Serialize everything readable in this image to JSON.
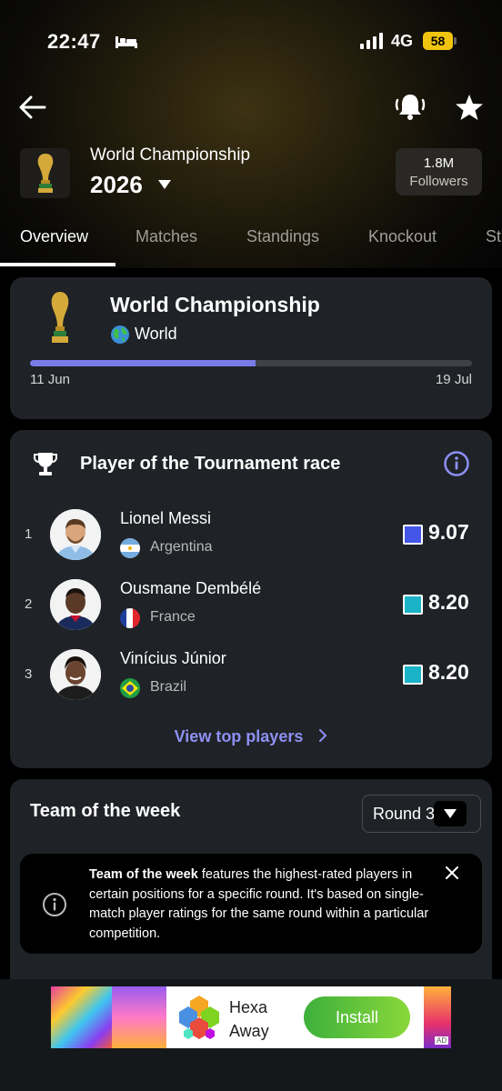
{
  "status_bar": {
    "time": "22:47",
    "network": "4G",
    "battery": "58"
  },
  "header": {
    "league_name": "World Championship",
    "season": "2026",
    "followers_count": "1.8M",
    "followers_label": "Followers"
  },
  "tabs": [
    {
      "label": "Overview",
      "active": true
    },
    {
      "label": "Matches",
      "active": false
    },
    {
      "label": "Standings",
      "active": false
    },
    {
      "label": "Knockout",
      "active": false
    },
    {
      "label": "St",
      "active": false
    }
  ],
  "competition_card": {
    "title": "World Championship",
    "region": "World",
    "start_date": "11 Jun",
    "end_date": "19 Jul",
    "progress": 0.51
  },
  "potm": {
    "title": "Player of the Tournament race",
    "players": [
      {
        "rank": "1",
        "name": "Lionel Messi",
        "country": "Argentina",
        "rating": "9.07",
        "color": "#4356e8"
      },
      {
        "rank": "2",
        "name": "Ousmane Dembélé",
        "country": "France",
        "rating": "8.20",
        "color": "#1ab3c7"
      },
      {
        "rank": "3",
        "name": "Vinícius Júnior",
        "country": "Brazil",
        "rating": "8.20",
        "color": "#1ab3c7"
      }
    ],
    "view_more": "View top players"
  },
  "team_of_week": {
    "title": "Team of the week",
    "round": "Round 3",
    "info_bold": "Team of the week",
    "info_text": " features the highest-rated players in certain positions for a specific round. It's based on single-match player ratings for the same round within a particular competition."
  },
  "ad": {
    "title": "Hexa Away",
    "install": "Install",
    "badge": "AD"
  },
  "colors": {
    "accent": "#8d90f2",
    "progress": "#7a7be9",
    "card": "#1f2226"
  }
}
